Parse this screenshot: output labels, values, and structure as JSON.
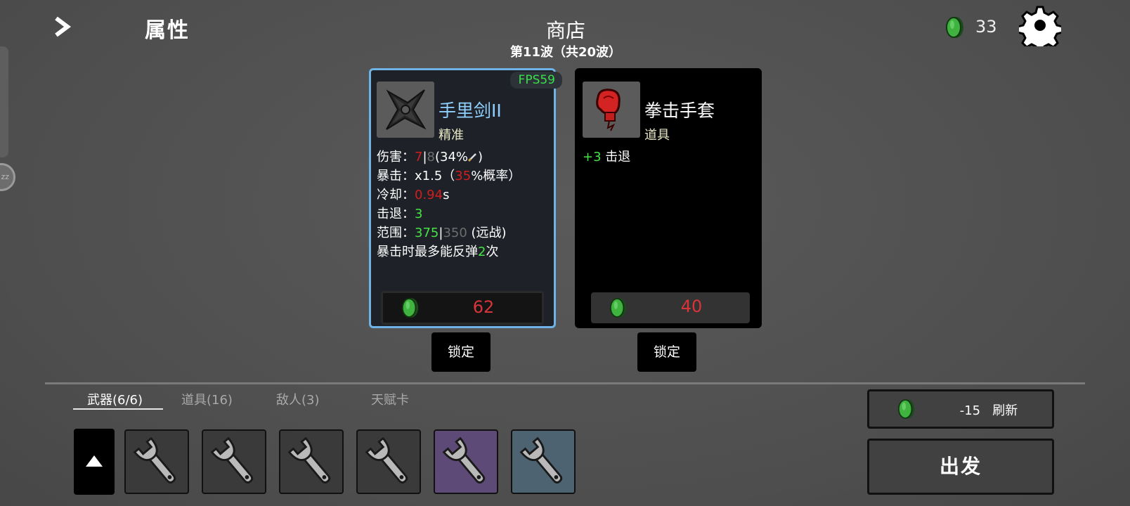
{
  "header": {
    "attributes_label": "属性",
    "shop_title": "商店",
    "wave_text": "第11波（共20波）",
    "gold_count": "33"
  },
  "overlay": {
    "fps": "FPS59",
    "side_circle_text": "zz"
  },
  "shop_items": [
    {
      "name": "手里剑II",
      "type": "精准",
      "icon": "shuriken-icon",
      "price": "62",
      "stats": {
        "damage_label": "伤害：",
        "damage_value": "7",
        "damage_sep": "|",
        "damage_base": "8",
        "damage_scaling": "(34%",
        "damage_close": ")",
        "crit_label": "暴击：",
        "crit_mult": "x1.5（",
        "crit_chance": "35",
        "crit_suffix": "%概率）",
        "cooldown_label": "冷却：",
        "cooldown_value": "0.94",
        "cooldown_unit": "s",
        "knockback_label": "击退：",
        "knockback_value": "3",
        "range_label": "范围：",
        "range_value": "375",
        "range_sep": "|",
        "range_base": "350",
        "range_type": " (远战)",
        "bounce_prefix": "暴击时最多能反弹",
        "bounce_value": "2",
        "bounce_suffix": "次"
      },
      "lock_label": "锁定"
    },
    {
      "name": "拳击手套",
      "type": "道具",
      "icon": "boxing-glove-icon",
      "price": "40",
      "effect_value": "+3",
      "effect_text": " 击退",
      "lock_label": "锁定"
    }
  ],
  "tabs": [
    {
      "label": "武器(6/6)",
      "active": true
    },
    {
      "label": "道具(16)",
      "active": false
    },
    {
      "label": "敌人(3)",
      "active": false
    },
    {
      "label": "天赋卡",
      "active": false
    }
  ],
  "inventory": [
    {
      "icon": "wrench-icon",
      "tier": "common"
    },
    {
      "icon": "wrench-icon",
      "tier": "common"
    },
    {
      "icon": "wrench-icon",
      "tier": "common"
    },
    {
      "icon": "wrench-icon",
      "tier": "common"
    },
    {
      "icon": "wrench-icon",
      "tier": "rare"
    },
    {
      "icon": "wrench-icon",
      "tier": "uncommon"
    }
  ],
  "actions": {
    "refresh_cost": "-15",
    "refresh_label": "刷新",
    "go_label": "出发"
  },
  "colors": {
    "accent_border": "#6fb3e6",
    "price_red": "#d8353b",
    "stat_red": "#d01e1e",
    "stat_green": "#46e246",
    "coin_green": "#3fb23f"
  }
}
